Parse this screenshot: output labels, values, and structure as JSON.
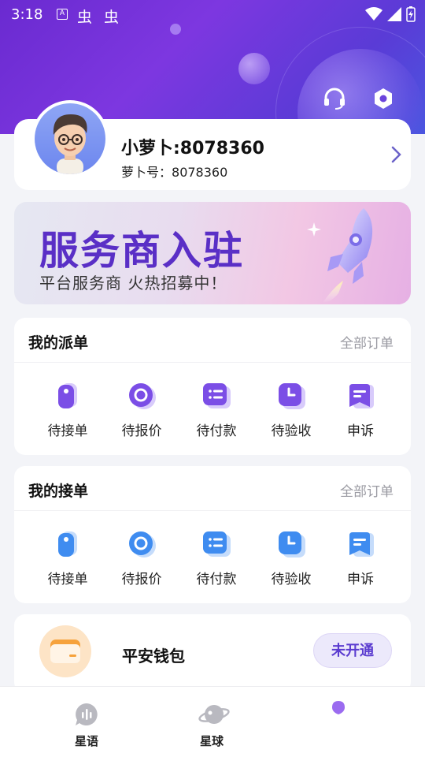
{
  "status_bar": {
    "time": "3:18",
    "a_badge": "A",
    "glyphs": [
      "虫",
      "虫"
    ]
  },
  "profile": {
    "name": "小萝卜:8078360",
    "id_label": "萝卜号：",
    "id_value": "8078360"
  },
  "banner": {
    "title": "服务商入驻",
    "subtitle": "平台服务商 火热招募中！"
  },
  "dispatch_section": {
    "title": "我的派单",
    "all_orders": "全部订单",
    "items": [
      {
        "label": "待接单",
        "icon": "tag-icon"
      },
      {
        "label": "待报价",
        "icon": "ring-icon"
      },
      {
        "label": "待付款",
        "icon": "list-icon"
      },
      {
        "label": "待验收",
        "icon": "clock-icon"
      },
      {
        "label": "申诉",
        "icon": "ticket-icon"
      }
    ],
    "accent": "#7b4ee6"
  },
  "accept_section": {
    "title": "我的接单",
    "all_orders": "全部订单",
    "items": [
      {
        "label": "待接单",
        "icon": "tag-icon"
      },
      {
        "label": "待报价",
        "icon": "ring-icon"
      },
      {
        "label": "待付款",
        "icon": "list-icon"
      },
      {
        "label": "待验收",
        "icon": "clock-icon"
      },
      {
        "label": "申诉",
        "icon": "ticket-icon"
      }
    ],
    "accent": "#3f8cf0"
  },
  "wallet": {
    "title": "平安钱包",
    "button": "未开通"
  },
  "tabbar": {
    "tabs": [
      {
        "label": "星语",
        "icon": "chat-bubble-icon"
      },
      {
        "label": "星球",
        "icon": "planet-icon"
      },
      {
        "label": "",
        "icon": "profile-dot-icon"
      }
    ]
  }
}
